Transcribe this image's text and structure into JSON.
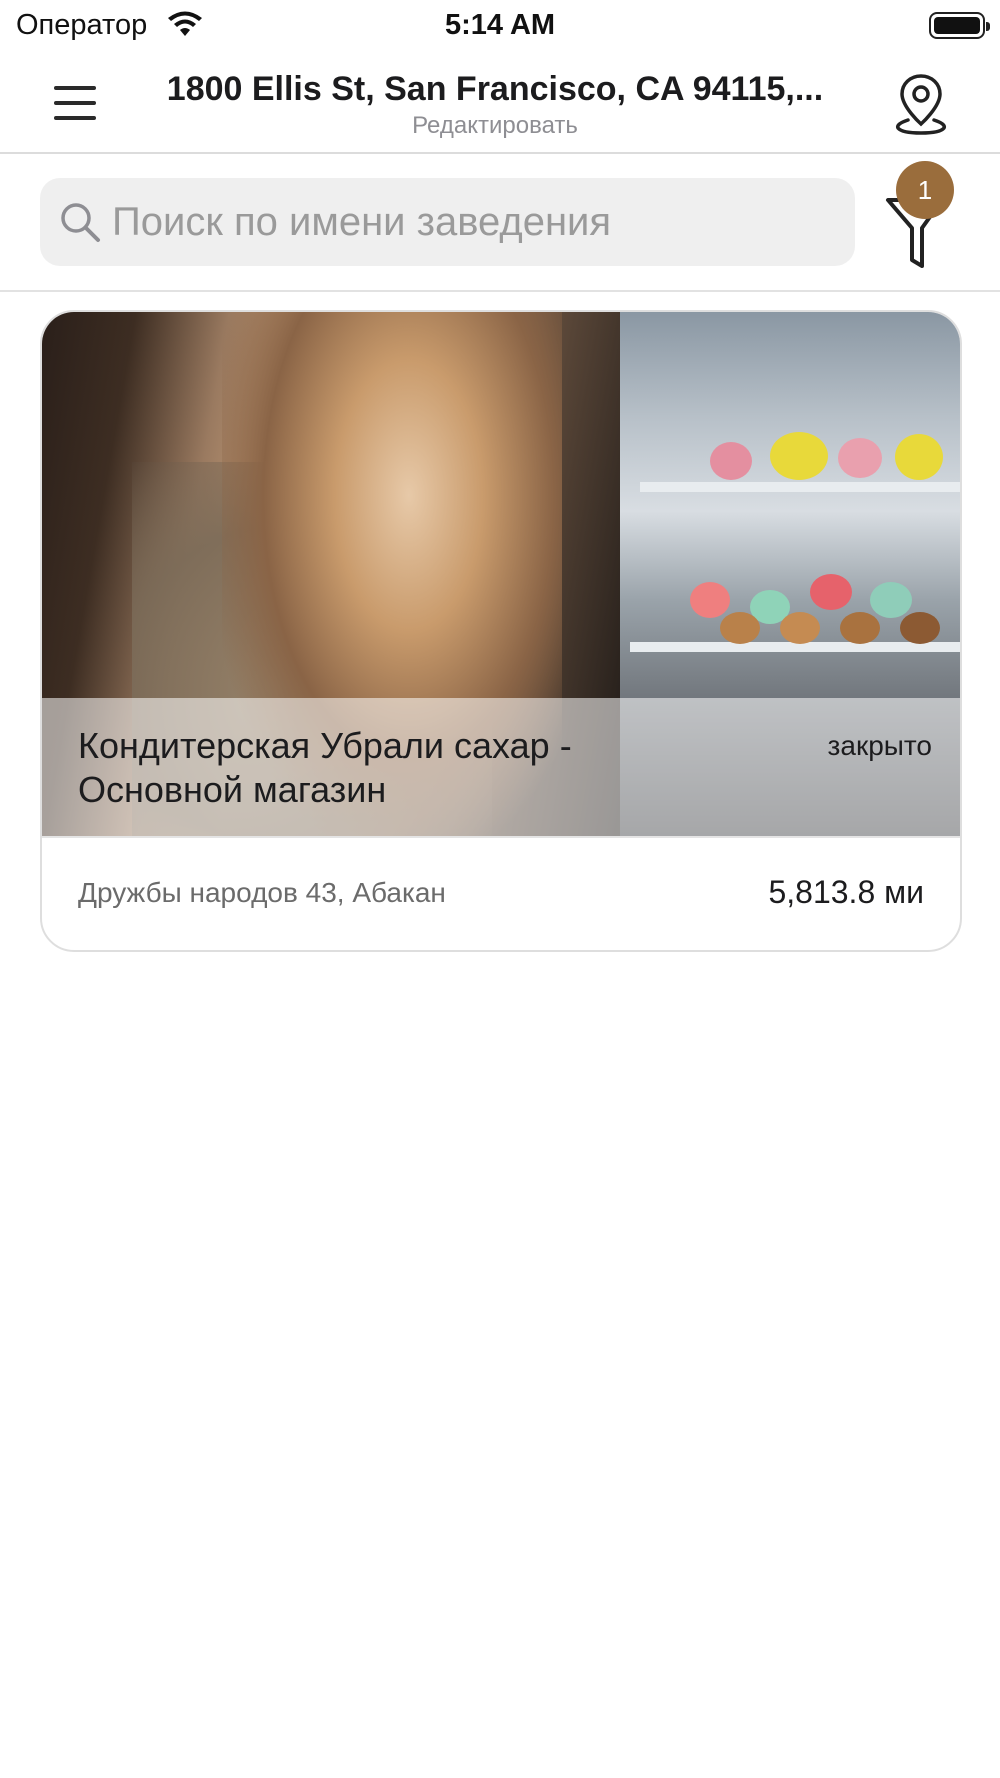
{
  "status_bar": {
    "carrier": "Оператор",
    "time": "5:14 AM"
  },
  "nav": {
    "title": "1800 Ellis St, San Francisco, CA 94115,...",
    "subtitle": "Редактировать",
    "menu_icon": "hamburger-menu-icon",
    "location_icon": "map-pin-icon"
  },
  "search": {
    "placeholder": "Поиск по имени заведения",
    "value": "",
    "filter_icon": "filter-funnel-icon",
    "filter_badge": "1",
    "badge_color": "#9a6d3c"
  },
  "places": [
    {
      "name": "Кондитерская Убрали сахар - Основной магазин",
      "status": "закрыто",
      "address": "Дружбы народов 43, Абакан",
      "distance": "5,813.8 ми"
    }
  ]
}
